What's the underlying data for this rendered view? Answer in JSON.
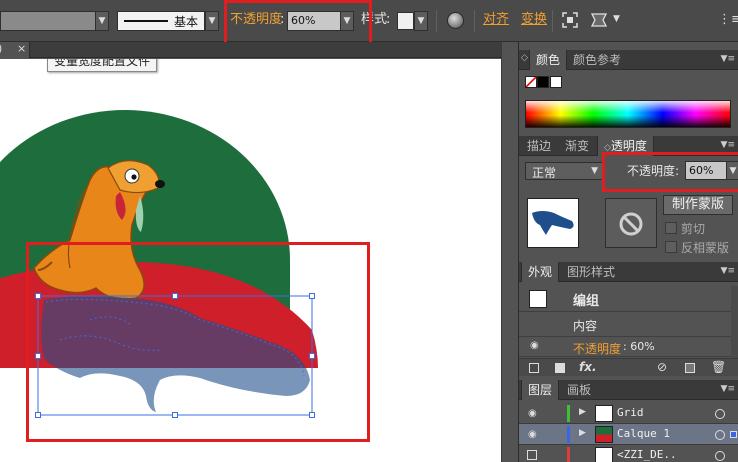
{
  "control_bar": {
    "stroke_profile_label": "基本",
    "opacity_label": "不透明度",
    "opacity_colon": ":",
    "opacity_value": "60%",
    "style_label": "样式",
    "style_colon": ":",
    "align_label": "对齐",
    "transform_label": "变换"
  },
  "canvas": {
    "tooltip": "变量宽度配置文件"
  },
  "color_panel": {
    "tabs": [
      "颜色",
      "颜色参考"
    ]
  },
  "transparency_panel": {
    "tabs": [
      "描边",
      "渐变",
      "透明度"
    ],
    "blend_mode": "正常",
    "opacity_label": "不透明度:",
    "opacity_value": "60%",
    "make_mask_button": "制作蒙版",
    "clip_label": "剪切",
    "invert_mask_label": "反相蒙版"
  },
  "appearance_panel": {
    "tabs": [
      "外观",
      "图形样式"
    ],
    "group_label": "编组",
    "content_label": "内容",
    "opacity_label": "不透明度",
    "opacity_value": ": 60%",
    "fx_label": "fx."
  },
  "layers_panel": {
    "tabs": [
      "图层",
      "画板"
    ],
    "layers": [
      {
        "name": "Grid",
        "color": "#3cc03c"
      },
      {
        "name": "Calque 1",
        "color": "#3c64e6"
      },
      {
        "name": "<ZZI_DE..",
        "color": "#e03c3c"
      }
    ]
  },
  "colors": {
    "accent_orange": "#f0a030",
    "highlight_red": "#e01e1e",
    "selection_blue": "#3b6fe0",
    "artwork_green": "#1d6e3c",
    "artwork_red": "#cf1f2a"
  }
}
